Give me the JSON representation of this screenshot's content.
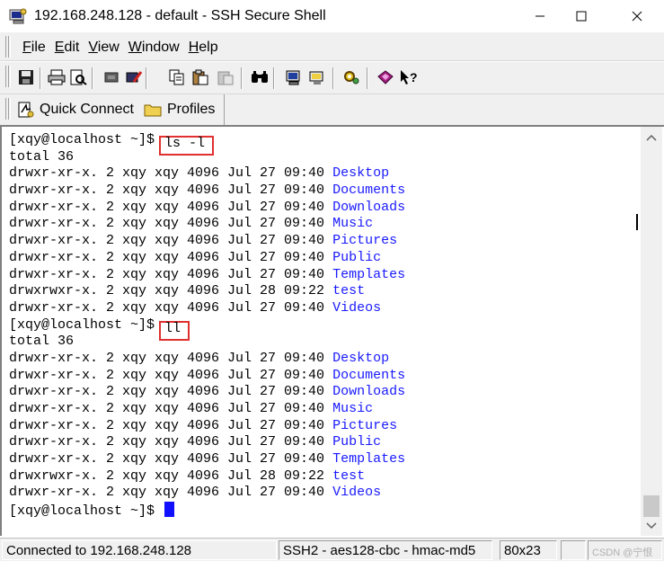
{
  "window": {
    "title": "192.168.248.128 - default - SSH Secure Shell",
    "min_glyph": "—",
    "max_glyph": "☐",
    "close_glyph": "✕"
  },
  "menu": {
    "items": [
      {
        "key": "F",
        "rest": "ile"
      },
      {
        "key": "E",
        "rest": "dit"
      },
      {
        "key": "V",
        "rest": "iew"
      },
      {
        "key": "W",
        "rest": "indow"
      },
      {
        "key": "H",
        "rest": "elp"
      }
    ]
  },
  "toolbar": {
    "icons": [
      "save-icon",
      "print-icon",
      "print-preview-icon",
      "disconnect-icon",
      "connect-icon",
      "copy-icon",
      "paste-icon",
      "paste-disabled-icon",
      "find-icon",
      "settings-icon",
      "profiles-icon",
      "preferences-icon",
      "about-icon",
      "help-context-icon"
    ]
  },
  "quickbar": {
    "quick_connect": "Quick Connect",
    "profiles": "Profiles"
  },
  "terminal": {
    "prompt": "[xqy@localhost ~]$ ",
    "cmd1": "ls -l",
    "cmd2": "ll",
    "total": "total 36",
    "listing1": [
      {
        "meta": "drwxr-xr-x. 2 xqy xqy 4096 Jul 27 09:40 ",
        "name": "Desktop"
      },
      {
        "meta": "drwxr-xr-x. 2 xqy xqy 4096 Jul 27 09:40 ",
        "name": "Documents"
      },
      {
        "meta": "drwxr-xr-x. 2 xqy xqy 4096 Jul 27 09:40 ",
        "name": "Downloads"
      },
      {
        "meta": "drwxr-xr-x. 2 xqy xqy 4096 Jul 27 09:40 ",
        "name": "Music"
      },
      {
        "meta": "drwxr-xr-x. 2 xqy xqy 4096 Jul 27 09:40 ",
        "name": "Pictures"
      },
      {
        "meta": "drwxr-xr-x. 2 xqy xqy 4096 Jul 27 09:40 ",
        "name": "Public"
      },
      {
        "meta": "drwxr-xr-x. 2 xqy xqy 4096 Jul 27 09:40 ",
        "name": "Templates"
      },
      {
        "meta": "drwxrwxr-x. 2 xqy xqy 4096 Jul 28 09:22 ",
        "name": "test"
      },
      {
        "meta": "drwxr-xr-x. 2 xqy xqy 4096 Jul 27 09:40 ",
        "name": "Videos"
      }
    ],
    "listing2": [
      {
        "meta": "drwxr-xr-x. 2 xqy xqy 4096 Jul 27 09:40 ",
        "name": "Desktop"
      },
      {
        "meta": "drwxr-xr-x. 2 xqy xqy 4096 Jul 27 09:40 ",
        "name": "Documents"
      },
      {
        "meta": "drwxr-xr-x. 2 xqy xqy 4096 Jul 27 09:40 ",
        "name": "Downloads"
      },
      {
        "meta": "drwxr-xr-x. 2 xqy xqy 4096 Jul 27 09:40 ",
        "name": "Music"
      },
      {
        "meta": "drwxr-xr-x. 2 xqy xqy 4096 Jul 27 09:40 ",
        "name": "Pictures"
      },
      {
        "meta": "drwxr-xr-x. 2 xqy xqy 4096 Jul 27 09:40 ",
        "name": "Public"
      },
      {
        "meta": "drwxr-xr-x. 2 xqy xqy 4096 Jul 27 09:40 ",
        "name": "Templates"
      },
      {
        "meta": "drwxrwxr-x. 2 xqy xqy 4096 Jul 28 09:22 ",
        "name": "test"
      },
      {
        "meta": "drwxr-xr-x. 2 xqy xqy 4096 Jul 27 09:40 ",
        "name": "Videos"
      }
    ],
    "colors": {
      "dir": "#1a1aff",
      "highlight_box": "#e03030",
      "cursor": "#1010ff"
    }
  },
  "status": {
    "connection": "Connected to 192.168.248.128",
    "cipher": "SSH2 - aes128-cbc - hmac-md5",
    "size": "80x23",
    "watermark": "CSDN @宁恨"
  }
}
